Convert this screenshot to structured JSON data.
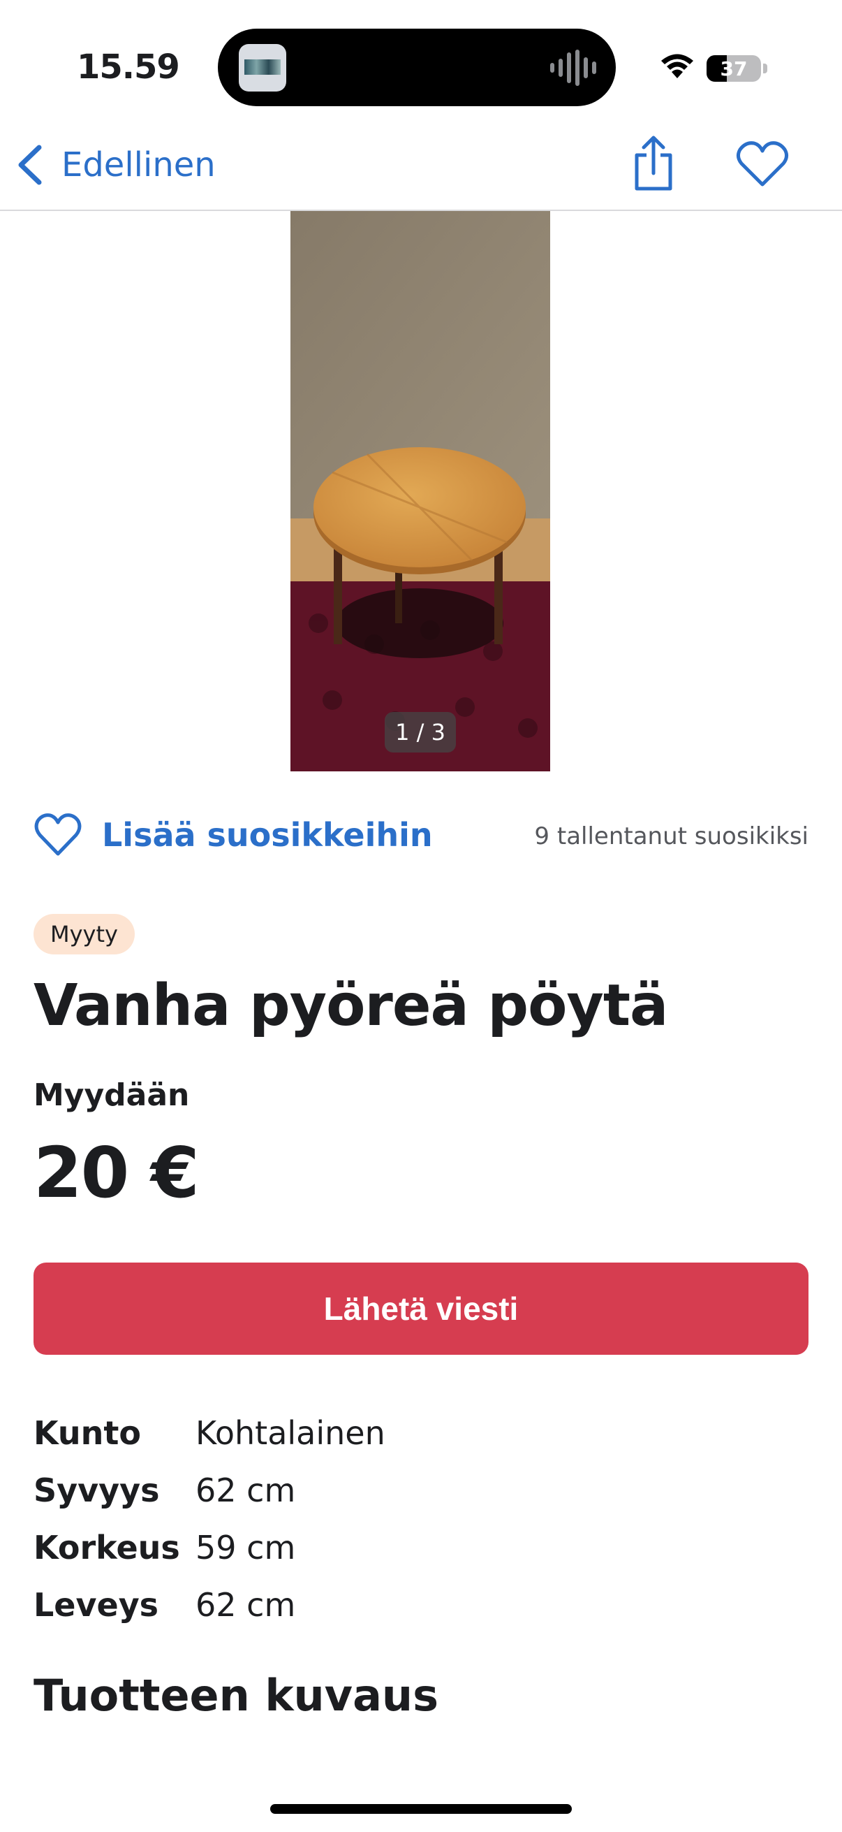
{
  "status_bar": {
    "time": "15.59",
    "battery": "37",
    "battery_level": 0.37
  },
  "nav": {
    "back_label": "Edellinen"
  },
  "image": {
    "counter": "1 / 3"
  },
  "favorites": {
    "add_label": "Lisää suosikkeihin",
    "count_text": "9 tallentanut suosikiksi"
  },
  "listing": {
    "status_badge": "Myyty",
    "title": "Vanha pyöreä pöytä",
    "sale_type": "Myydään",
    "price": "20 €",
    "message_button": "Lähetä viesti",
    "specs": [
      {
        "label": "Kunto",
        "value": "Kohtalainen"
      },
      {
        "label": "Syvyys",
        "value": "62 cm"
      },
      {
        "label": "Korkeus",
        "value": "59 cm"
      },
      {
        "label": "Leveys",
        "value": "62 cm"
      }
    ],
    "description_heading": "Tuotteen kuvaus"
  },
  "colors": {
    "accent_blue": "#2b6fc9",
    "primary_button": "#d63d50",
    "badge_background": "#fde4d2"
  }
}
